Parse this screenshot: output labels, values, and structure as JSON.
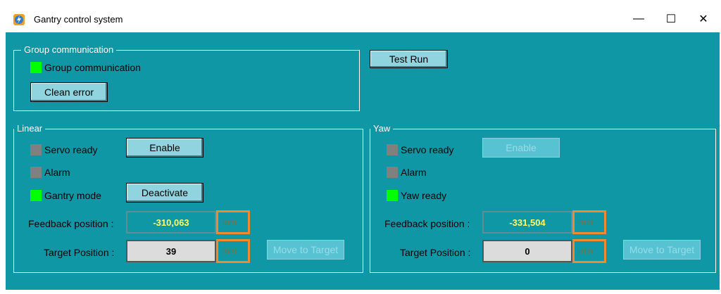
{
  "window": {
    "title": "Gantry control system",
    "minimize_glyph": "—",
    "maximize_glyph": "☐",
    "close_glyph": "✕"
  },
  "group_comm": {
    "legend": "Group communication",
    "indicator_label": "Group communication",
    "indicator_color": "#00ff00",
    "clean_error_label": "Clean error"
  },
  "test_run": {
    "label": "Test Run"
  },
  "linear": {
    "legend": "Linear",
    "servo_ready_label": "Servo ready",
    "alarm_label": "Alarm",
    "gantry_mode_label": "Gantry mode",
    "enable_label": "Enable",
    "deactivate_label": "Deactivate",
    "feedback_label": "Feedback position :",
    "feedback_value": "-310,063",
    "feedback_unit": "mm",
    "target_label": "Target Position :",
    "target_value": "39",
    "target_unit": "mm",
    "move_label": "Move to Target"
  },
  "yaw": {
    "legend": "Yaw",
    "servo_ready_label": "Servo ready",
    "alarm_label": "Alarm",
    "yaw_ready_label": "Yaw ready",
    "enable_label": "Enable",
    "feedback_label": "Feedback position :",
    "feedback_value": "-331,504",
    "feedback_unit": "mm",
    "target_label": "Target Position :",
    "target_value": "0",
    "target_unit": "mm",
    "move_label": "Move to Target"
  },
  "colors": {
    "background": "#0f97a6",
    "led_on": "#00ff00",
    "led_off": "#808080",
    "unit_border": "#f08a30",
    "feedback_text": "#ffff66"
  }
}
